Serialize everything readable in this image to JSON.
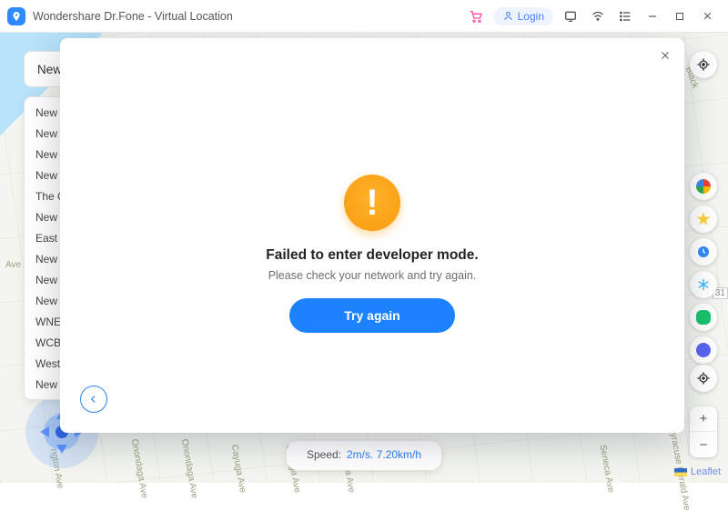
{
  "titlebar": {
    "title": "Wondershare Dr.Fone - Virtual Location",
    "login_label": "Login"
  },
  "search": {
    "value": "New York",
    "suggestions": [
      "New York",
      "New York",
      "New York",
      "New York",
      "The City",
      "New York",
      "East New",
      "New York",
      "New York",
      "New York",
      "WNEW-",
      "WCBS-F",
      "West New",
      "New York"
    ]
  },
  "modal": {
    "title": "Failed to enter developer mode.",
    "subtitle": "Please check your network and try again.",
    "retry_label": "Try again"
  },
  "speed": {
    "label": "Speed:",
    "value": "2m/s. 7.20km/h"
  },
  "map": {
    "street_labels": [
      "ngton Ave",
      "Onondaga Ave",
      "Onondaga Ave",
      "Cayuga Ave",
      "Cayuga Ave",
      "Seneca Ave",
      "Seneca Ave",
      "Syracuse Herald Ave"
    ],
    "label_ave": "Ave",
    "label_top_right": "Black",
    "label_31": "31",
    "attribution": "Leaflet"
  },
  "icons": {
    "gmaps": "google-maps-icon",
    "fav": "star-icon",
    "history": "clock-icon",
    "cool": "snowflake-icon",
    "game": "gamepad-icon",
    "discord": "discord-icon",
    "center": "target-icon",
    "locate": "crosshair-icon",
    "zoom_in": "+",
    "zoom_out": "−"
  }
}
